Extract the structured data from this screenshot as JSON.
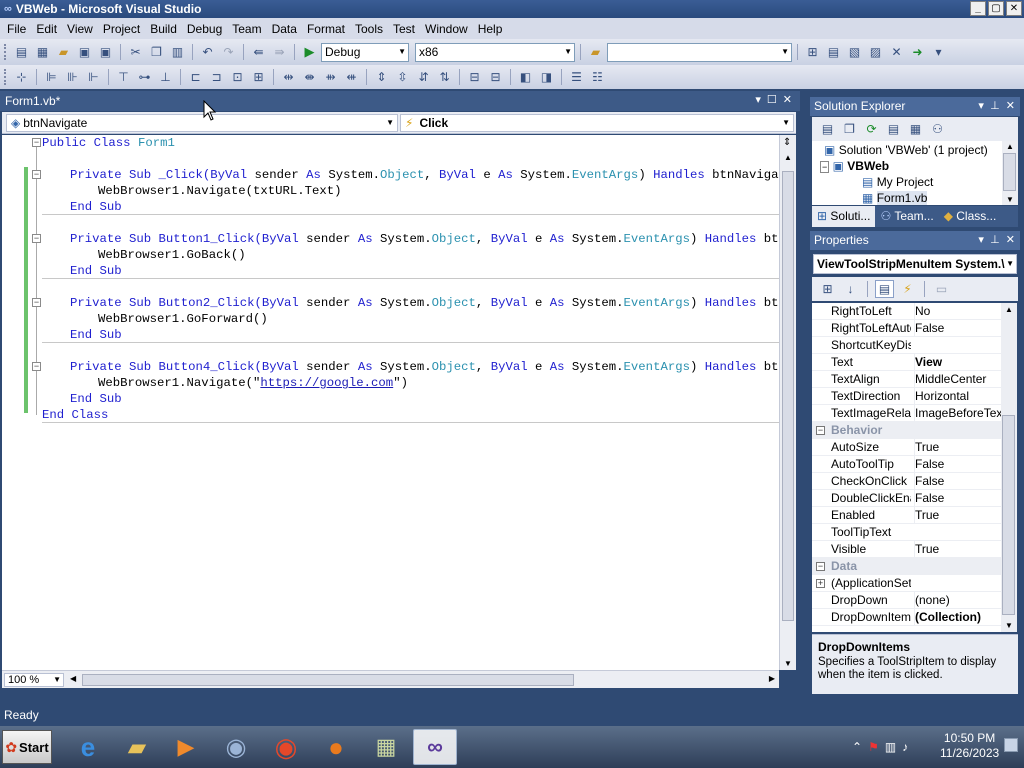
{
  "window": {
    "title": "VBWeb - Microsoft Visual Studio",
    "controls": [
      "_",
      "▢",
      "✕"
    ]
  },
  "menu": [
    "File",
    "Edit",
    "View",
    "Project",
    "Build",
    "Debug",
    "Team",
    "Data",
    "Format",
    "Tools",
    "Test",
    "Window",
    "Help"
  ],
  "toolbar": {
    "config": "Debug",
    "platform": "x86",
    "find_value": ""
  },
  "editor": {
    "tab_title": "Form1.vb*",
    "nav_left": "btnNavigate",
    "nav_right": "Click",
    "zoom": "100 %"
  },
  "code": {
    "line1": [
      "Public Class",
      "Form1"
    ],
    "sub1_decl": [
      "Private Sub _Click(",
      "ByVal",
      " sender ",
      "As",
      " System.",
      "Object",
      ", ",
      "ByVal",
      " e ",
      "As",
      " System.",
      "EventArgs",
      ") ",
      "Handles",
      " btnNavigate.Cl"
    ],
    "sub1_body": "WebBrowser1.Navigate(txtURL.Text)",
    "sub2_decl": [
      "Private Sub Button1_Click(",
      "ByVal",
      " sender ",
      "As",
      " System.",
      "Object",
      ", ",
      "ByVal",
      " e ",
      "As",
      " System.",
      "EventArgs",
      ") ",
      "Handles",
      " btnGoBac"
    ],
    "sub2_body": "WebBrowser1.GoBack()",
    "sub3_decl": [
      "Private Sub Button2_Click(",
      "ByVal",
      " sender ",
      "As",
      " System.",
      "Object",
      ", ",
      "ByVal",
      " e ",
      "As",
      " System.",
      "EventArgs",
      ") ",
      "Handles",
      " btnGoFor"
    ],
    "sub3_body": "WebBrowser1.GoForward()",
    "sub4_decl": [
      "Private Sub Button4_Click(",
      "ByVal",
      " sender ",
      "As",
      " System.",
      "Object",
      ", ",
      "ByVal",
      " e ",
      "As",
      " System.",
      "EventArgs",
      ") ",
      "Handles",
      " btnHome"
    ],
    "sub4_body_pre": "WebBrowser1.Navigate(\"",
    "sub4_body_url": "https://google.com",
    "sub4_body_post": "\")",
    "end_sub": "End Sub",
    "end_class": "End Class"
  },
  "solution_explorer": {
    "title": "Solution Explorer",
    "tree": {
      "solution": "Solution 'VBWeb' (1 project)",
      "project": "VBWeb",
      "my_project": "My Project",
      "form": "Form1.vb"
    },
    "tabs": [
      "Soluti...",
      "Team...",
      "Class..."
    ]
  },
  "properties": {
    "title": "Properties",
    "object": "ViewToolStripMenuItem System.\\",
    "rows": [
      {
        "name": "RightToLeft",
        "value": "No"
      },
      {
        "name": "RightToLeftAuto",
        "value": "False"
      },
      {
        "name": "ShortcutKeyDisp",
        "value": ""
      },
      {
        "name": "Text",
        "value": "View",
        "bold": true
      },
      {
        "name": "TextAlign",
        "value": "MiddleCenter"
      },
      {
        "name": "TextDirection",
        "value": "Horizontal"
      },
      {
        "name": "TextImageRelati",
        "value": "ImageBeforeText"
      }
    ],
    "cat_behavior": "Behavior",
    "behavior_rows": [
      {
        "name": "AutoSize",
        "value": "True"
      },
      {
        "name": "AutoToolTip",
        "value": "False"
      },
      {
        "name": "CheckOnClick",
        "value": "False"
      },
      {
        "name": "DoubleClickEnab",
        "value": "False"
      },
      {
        "name": "Enabled",
        "value": "True"
      },
      {
        "name": "ToolTipText",
        "value": ""
      },
      {
        "name": "Visible",
        "value": "True"
      }
    ],
    "cat_data": "Data",
    "data_rows": [
      {
        "name": "(ApplicationSetti",
        "value": ""
      },
      {
        "name": "DropDown",
        "value": "(none)"
      },
      {
        "name": "DropDownItems",
        "value": "(Collection)",
        "bold": true
      }
    ],
    "desc_title": "DropDownItems",
    "desc_text": "Specifies a ToolStripItem to display when the item is clicked."
  },
  "status": "Ready",
  "taskbar": {
    "start": "Start",
    "time": "10:50 PM",
    "date": "11/26/2023"
  }
}
